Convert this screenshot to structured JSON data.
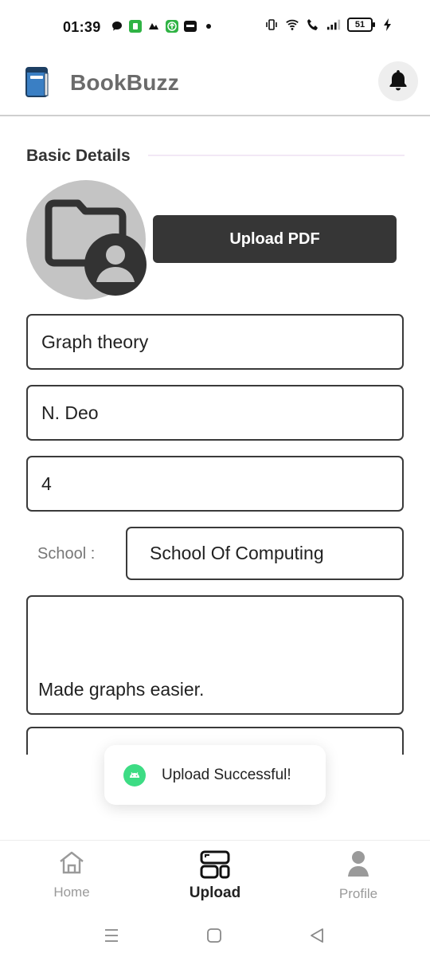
{
  "status_bar": {
    "time": "01:39",
    "battery": "51",
    "icons_left": [
      "chat-icon",
      "app-icon",
      "app-icon",
      "upload-icon",
      "app-icon",
      "dot-icon"
    ],
    "icons_right": [
      "vibrate-icon",
      "wifi-icon",
      "call-icon",
      "signal-icon",
      "battery-icon",
      "charging-icon"
    ]
  },
  "header": {
    "title": "BookBuzz",
    "logo_icon": "book-icon",
    "notification_icon": "bell-icon"
  },
  "section": {
    "title": "Basic Details"
  },
  "upload": {
    "button_label": "Upload PDF",
    "avatar_icon": "folder-user-icon"
  },
  "form": {
    "title_value": "Graph theory",
    "author_value": "N. Deo",
    "semester_value": "4",
    "school_label": "School :",
    "school_value": "School Of Computing",
    "description_value": "Made graphs easier.",
    "extra_value": ""
  },
  "toast": {
    "message": "Upload Successful!",
    "icon": "android-icon"
  },
  "bottom_nav": {
    "items": [
      {
        "label": "Home",
        "icon": "home-icon",
        "active": false
      },
      {
        "label": "Upload",
        "icon": "upload-layout-icon",
        "active": true
      },
      {
        "label": "Profile",
        "icon": "person-icon",
        "active": false
      }
    ]
  },
  "system_nav": [
    "menu-icon",
    "home-square-icon",
    "back-icon"
  ],
  "colors": {
    "accent_dark": "#363636",
    "title_gray": "#6b6b6b",
    "toast_icon_green": "#3ddc84"
  }
}
